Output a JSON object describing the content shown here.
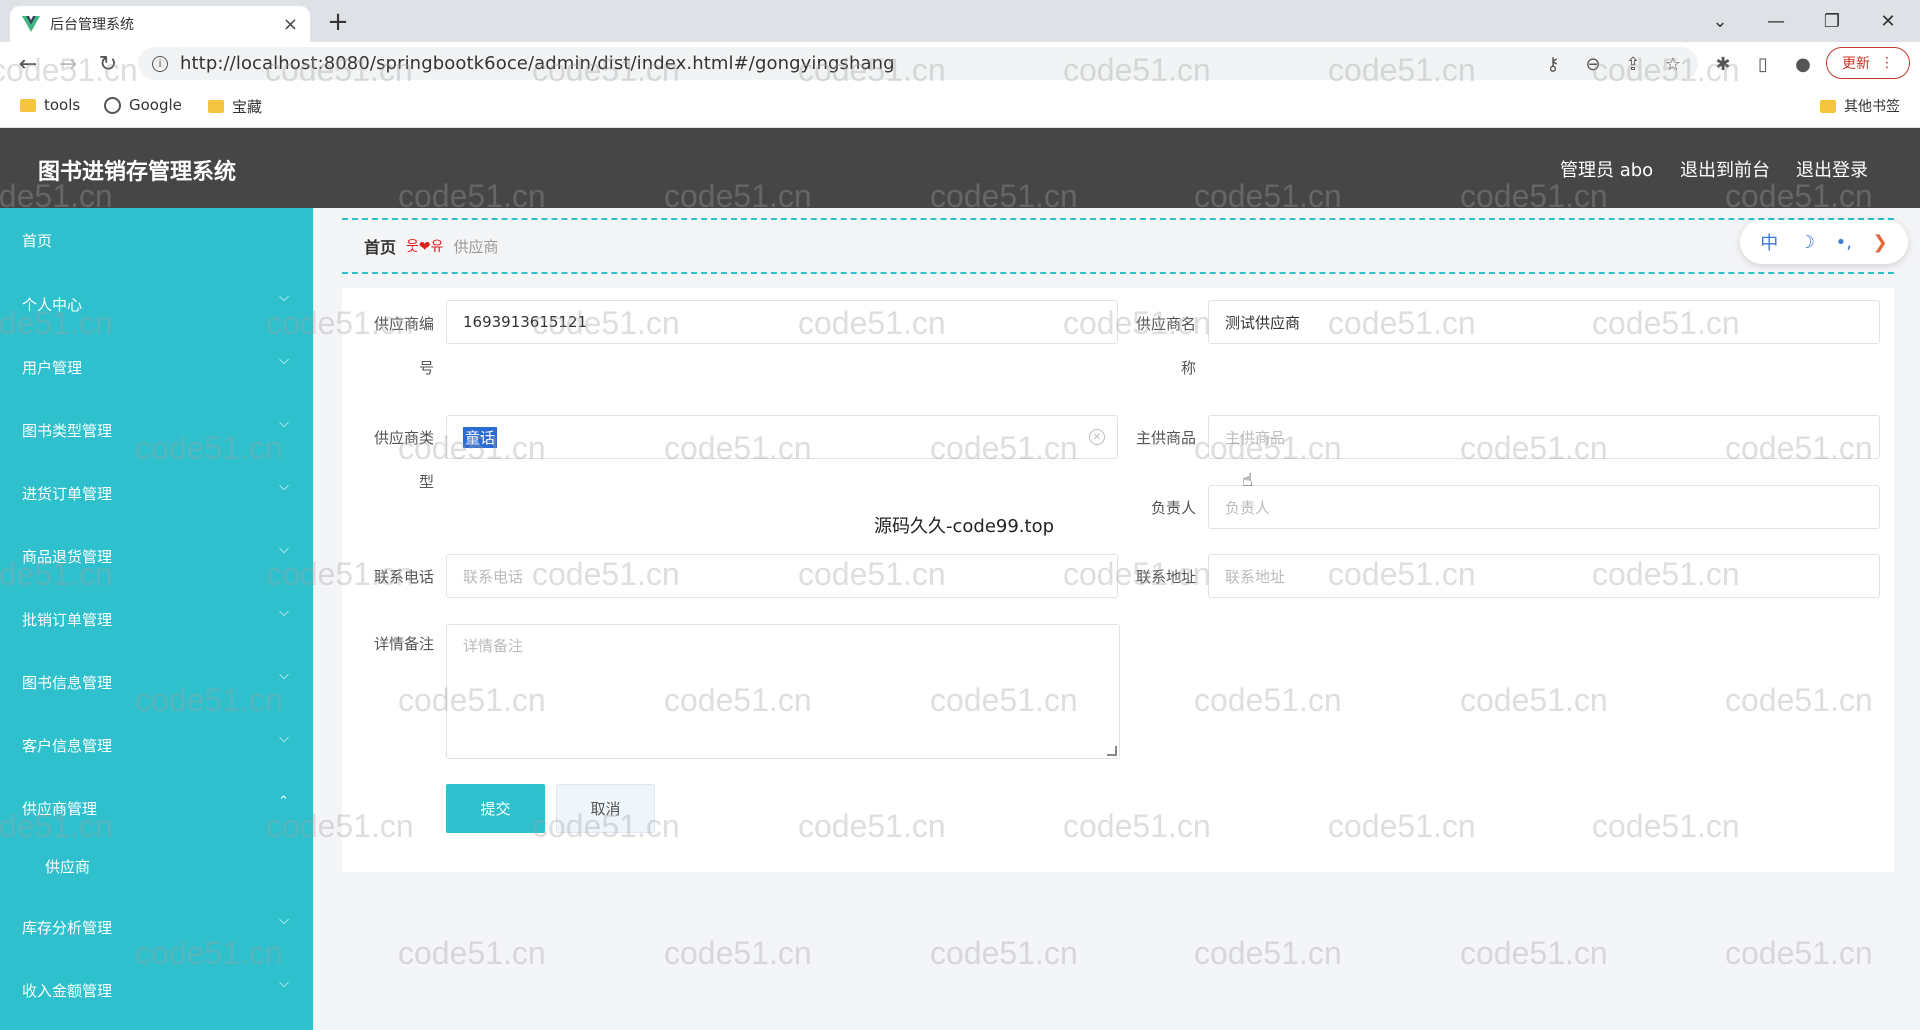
{
  "browser": {
    "tab_title": "后台管理系统",
    "tab_close": "×",
    "new_tab": "+",
    "url": "http://localhost:8080/springbootk6oce/admin/dist/index.html#/gongyingshang",
    "update_label": "更新",
    "bookmarks": [
      "tools",
      "Google",
      "宝藏"
    ],
    "other_bookmarks": "其他书签"
  },
  "header": {
    "title": "图书进销存管理系统",
    "user": "管理员 abo",
    "to_front": "退出到前台",
    "logout": "退出登录"
  },
  "sidebar": {
    "items": [
      {
        "label": "首页"
      },
      {
        "label": "个人中心"
      },
      {
        "label": "用户管理"
      },
      {
        "label": "图书类型管理"
      },
      {
        "label": "进货订单管理"
      },
      {
        "label": "商品退货管理"
      },
      {
        "label": "批销订单管理"
      },
      {
        "label": "图书信息管理"
      },
      {
        "label": "客户信息管理"
      },
      {
        "label": "供应商管理"
      },
      {
        "label": "库存分析管理"
      },
      {
        "label": "收入金额管理"
      }
    ],
    "submenu": {
      "label": "供应商"
    }
  },
  "breadcrumb": {
    "home": "首页",
    "separator": "웃❤유",
    "current": "供应商"
  },
  "toolbar": {
    "lang": "中",
    "moon": "☽",
    "dots": "•,",
    "arrow": "❯"
  },
  "form": {
    "supplier_no": {
      "label_line1": "供应商编",
      "label_line2": "号",
      "value": "1693913615121"
    },
    "supplier_name": {
      "label_line1": "供应商名",
      "label_line2": "称",
      "value": "测试供应商"
    },
    "supplier_type": {
      "label_line1": "供应商类",
      "label_line2": "型",
      "value": "童话"
    },
    "main_goods": {
      "label": "主供商品",
      "placeholder": "主供商品"
    },
    "manager": {
      "label": "负责人",
      "placeholder": "负责人"
    },
    "phone": {
      "label": "联系电话",
      "placeholder": "联系电话"
    },
    "address": {
      "label": "联系地址",
      "placeholder": "联系地址"
    },
    "remark": {
      "label": "详情备注",
      "placeholder": "详情备注"
    },
    "submit_label": "提交",
    "cancel_label": "取消"
  },
  "overlay_text": "源码久久-code99.top",
  "watermark": "code51.cn",
  "colors": {
    "sidebar": "#2ec0cc",
    "header": "#464646",
    "accent": "#2ec0cc"
  }
}
